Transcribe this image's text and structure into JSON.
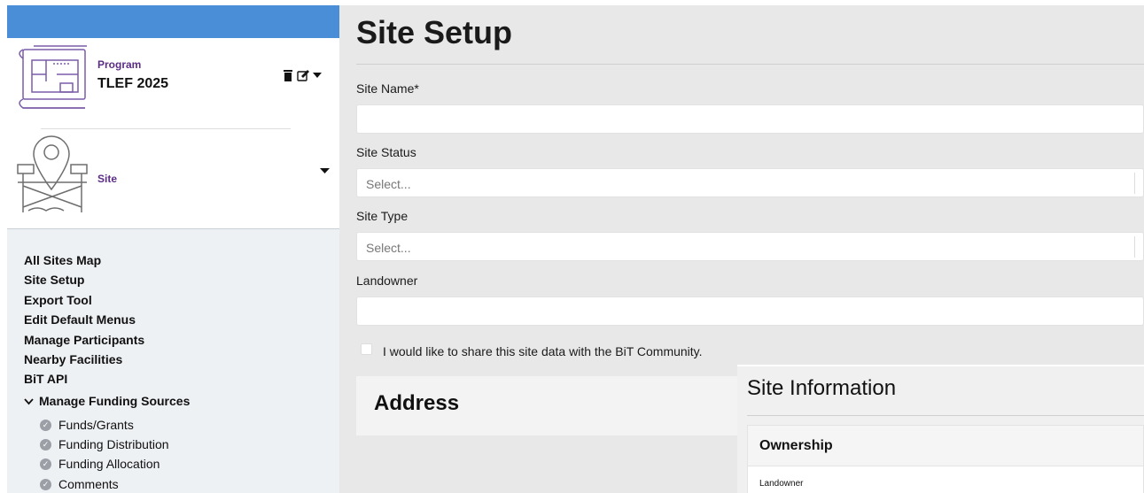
{
  "sidebar": {
    "program": {
      "label": "Program",
      "name": "TLEF 2025"
    },
    "site": {
      "label": "Site"
    },
    "nav_items": [
      "All Sites Map",
      "Site Setup",
      "Export Tool",
      "Edit Default Menus",
      "Manage Participants",
      "Nearby Facilities",
      "BiT API"
    ],
    "funding": {
      "heading": "Manage Funding Sources",
      "items": [
        "Funds/Grants",
        "Funding Distribution",
        "Funding Allocation",
        "Comments"
      ]
    },
    "icons": {
      "trash": "trash-icon",
      "edit": "edit-icon",
      "caret": "caret-down-icon",
      "chevron": "chevron-down-icon",
      "check": "check-circle-icon"
    },
    "colors": {
      "topbar": "#4a8ed8",
      "accent": "#5b2d86",
      "panel": "#eef1f4"
    }
  },
  "main": {
    "title": "Site Setup",
    "fields": {
      "site_name": {
        "label": "Site Name*",
        "value": ""
      },
      "site_status": {
        "label": "Site Status",
        "placeholder": "Select..."
      },
      "site_type": {
        "label": "Site Type",
        "placeholder": "Select..."
      },
      "landowner": {
        "label": "Landowner",
        "value": ""
      }
    },
    "share": {
      "label": "I would like to share this site data with the BiT Community.",
      "checked": false
    },
    "address": {
      "title": "Address"
    },
    "site_information": {
      "title": "Site Information",
      "ownership": {
        "title": "Ownership",
        "landowner_label": "Landowner"
      }
    },
    "colors": {
      "background": "#e8e8e8"
    }
  }
}
